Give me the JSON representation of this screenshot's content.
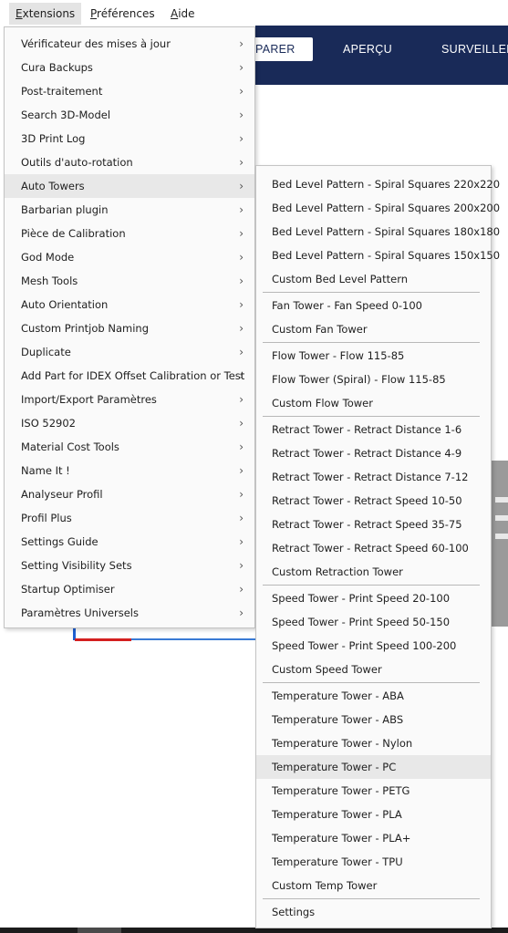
{
  "menubar": {
    "extensions": {
      "underline": "E",
      "rest": "xtensions"
    },
    "preferences": {
      "underline": "P",
      "rest": "références"
    },
    "help": {
      "underline": "A",
      "rest": "ide"
    }
  },
  "header": {
    "tabs": [
      "PARER",
      "APERÇU",
      "SURVEILLER"
    ]
  },
  "extensions_menu": {
    "items": [
      "Vérificateur des mises à jour",
      "Cura Backups",
      "Post-traitement",
      "Search 3D-Model",
      "3D Print Log",
      "Outils d'auto-rotation",
      "Auto Towers",
      "Barbarian plugin",
      "Pièce de Calibration",
      "God Mode",
      "Mesh Tools",
      "Auto Orientation",
      "Custom Printjob Naming",
      "Duplicate",
      "Add Part for IDEX Offset Calibration or Test",
      "Import/Export Paramètres",
      "ISO 52902",
      "Material Cost Tools",
      "Name It !",
      "Analyseur Profil",
      "Profil Plus",
      "Settings Guide",
      "Setting Visibility Sets",
      "Startup Optimiser",
      "Paramètres Universels"
    ],
    "submenu_arrow": "›"
  },
  "auto_towers_menu": {
    "groups": [
      [
        "Bed Level Pattern - Spiral Squares 220x220",
        "Bed Level Pattern - Spiral Squares 200x200",
        "Bed Level Pattern - Spiral Squares 180x180",
        "Bed Level Pattern - Spiral Squares 150x150",
        "Custom Bed Level Pattern"
      ],
      [
        "Fan Tower - Fan Speed 0-100",
        "Custom Fan Tower"
      ],
      [
        "Flow Tower - Flow 115-85",
        "Flow Tower (Spiral) - Flow 115-85",
        "Custom Flow Tower"
      ],
      [
        "Retract Tower - Retract Distance 1-6",
        "Retract Tower - Retract Distance 4-9",
        "Retract Tower - Retract Distance 7-12",
        "Retract Tower - Retract Speed 10-50",
        "Retract Tower - Retract Speed 35-75",
        "Retract Tower - Retract Speed 60-100",
        "Custom Retraction Tower"
      ],
      [
        "Speed Tower - Print Speed 20-100",
        "Speed Tower - Print Speed 50-150",
        "Speed Tower - Print Speed 100-200",
        "Custom Speed Tower"
      ],
      [
        "Temperature Tower - ABA",
        "Temperature Tower - ABS",
        "Temperature Tower - Nylon",
        "Temperature Tower - PC",
        "Temperature Tower - PETG",
        "Temperature Tower - PLA",
        "Temperature Tower - PLA+",
        "Temperature Tower - TPU",
        "Custom Temp Tower"
      ],
      [
        "Settings"
      ]
    ]
  }
}
